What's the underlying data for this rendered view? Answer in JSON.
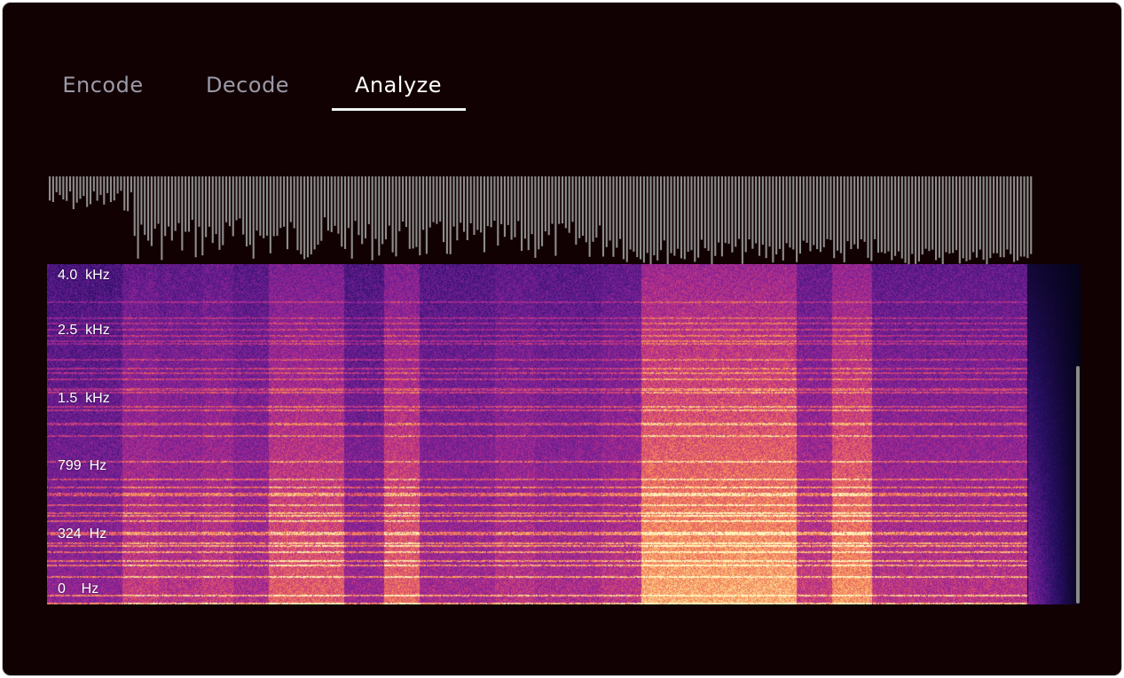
{
  "tabs": [
    {
      "label": "Encode",
      "active": false
    },
    {
      "label": "Decode",
      "active": false
    },
    {
      "label": "Analyze",
      "active": true
    }
  ],
  "spectrogram": {
    "frequency_labels": [
      "4.0  kHz",
      "2.5  kHz",
      "1.5  kHz",
      "799  Hz",
      "324  Hz",
      "0    Hz"
    ],
    "colors": {
      "background": "#120102",
      "waveform": "#8c8c8c",
      "low": "#1b0c41",
      "mid": "#8a2a9c",
      "high": "#f7a656",
      "peak": "#fff2b8"
    }
  }
}
